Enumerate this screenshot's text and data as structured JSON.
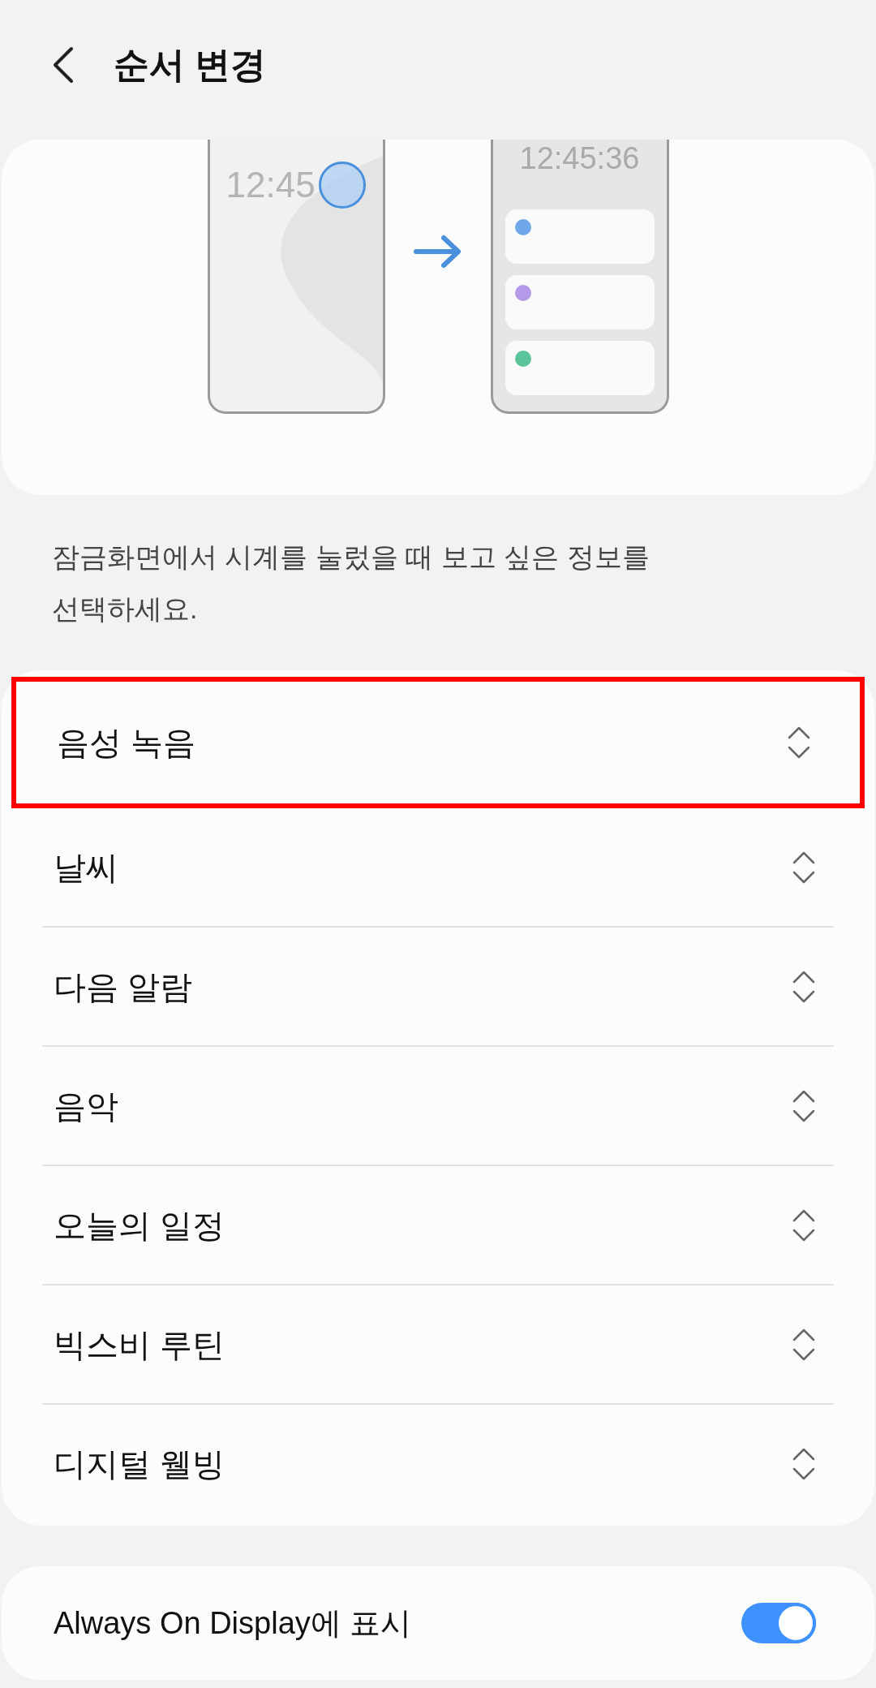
{
  "header": {
    "title": "순서 변경"
  },
  "illustration": {
    "lock_clock": "12:45",
    "panel_clock": "12:45:36",
    "cards": [
      {
        "color": "#6fa8e8"
      },
      {
        "color": "#b49ae8"
      },
      {
        "color": "#5cc49a"
      }
    ]
  },
  "description": "잠금화면에서 시계를 눌렀을 때 보고 싶은 정보를 선택하세요.",
  "items": [
    {
      "label": "음성 녹음",
      "highlighted": true
    },
    {
      "label": "날씨",
      "highlighted": false
    },
    {
      "label": "다음 알람",
      "highlighted": false
    },
    {
      "label": "음악",
      "highlighted": false
    },
    {
      "label": "오늘의 일정",
      "highlighted": false
    },
    {
      "label": "빅스비 루틴",
      "highlighted": false
    },
    {
      "label": "디지털 웰빙",
      "highlighted": false
    }
  ],
  "aod": {
    "label": "Always On Display에 표시",
    "on": true
  }
}
